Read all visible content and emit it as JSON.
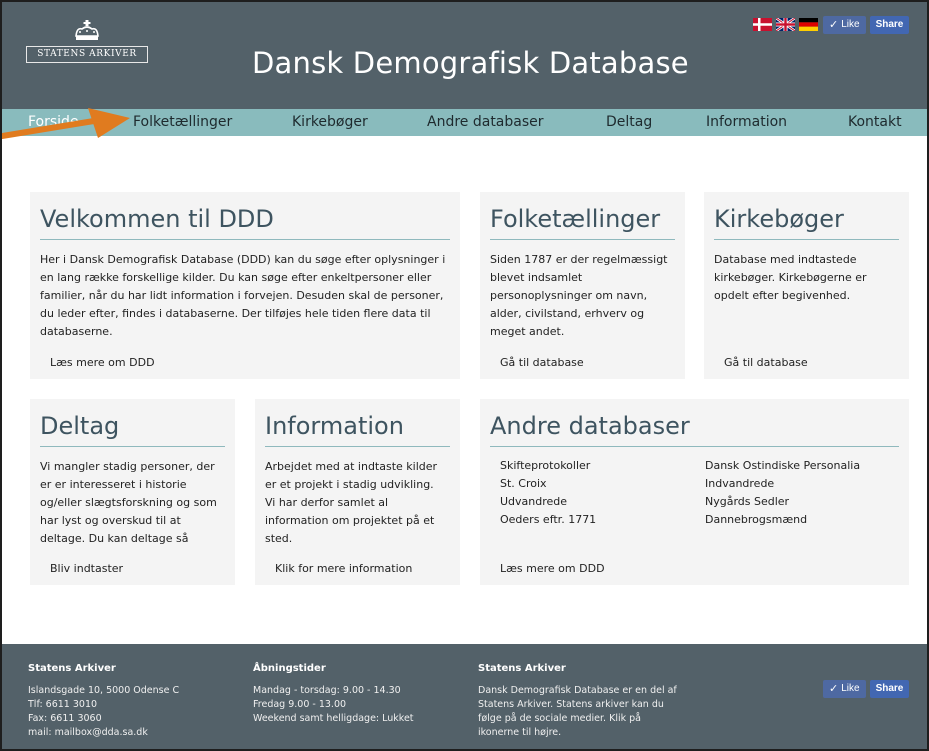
{
  "header": {
    "logo_text": "Statens Arkiver",
    "site_title": "Dansk Demografisk Database",
    "fb_like": "Like",
    "fb_share": "Share",
    "flags": [
      "danish-flag-icon",
      "uk-flag-icon",
      "german-flag-icon"
    ]
  },
  "nav": {
    "items": [
      "Forside",
      "Folketællinger",
      "Kirkebøger",
      "Andre databaser",
      "Deltag",
      "Information",
      "Kontakt"
    ]
  },
  "cards": {
    "welcome": {
      "title": "Velkommen til DDD",
      "lines": [
        "Her i Dansk Demografisk Database (DDD) kan du søge efter oplysninger i",
        "en lang række forskellige kilder. Du kan søge efter enkeltpersoner eller",
        "familier, når du har lidt information i forvejen. Desuden skal de personer,",
        "du leder efter, findes i databaserne. Der tilføjes hele tiden flere data til",
        "databaserne."
      ],
      "link": "Læs mere om DDD"
    },
    "census": {
      "title": "Folketællinger",
      "lines": [
        "Siden 1787 er der regelmæssigt",
        "blevet indsamlet",
        "personoplysninger om navn,",
        "alder, civilstand, erhverv og",
        "meget andet."
      ],
      "link": "Gå til database"
    },
    "church": {
      "title": "Kirkebøger",
      "lines": [
        "Database med indtastede",
        "kirkebøger. Kirkebøgerne er",
        "opdelt efter begivenhed."
      ],
      "link": "Gå til database"
    },
    "participate": {
      "title": "Deltag",
      "lines": [
        "Vi mangler stadig personer, der",
        "er er interesseret i historie",
        "og/eller slægtsforskning og som",
        "har lyst og overskud til at",
        "deltage. Du kan deltage så"
      ],
      "link": "Bliv indtaster"
    },
    "information": {
      "title": "Information",
      "lines": [
        "Arbejdet med at indtaste kilder",
        "er et projekt i stadig udvikling.",
        "Vi har derfor samlet al",
        "information om projektet på et",
        "sted."
      ],
      "link": "Klik for mere information"
    },
    "other": {
      "title": "Andre databaser",
      "col1": [
        "Skifteprotokoller",
        "St. Croix",
        "Udvandrede",
        "Oeders eftr. 1771"
      ],
      "col2": [
        "Dansk Ostindiske Personalia",
        "Indvandrede",
        "Nygårds Sedler",
        "Dannebrogsmænd"
      ],
      "link": "Læs mere om DDD"
    }
  },
  "footer": {
    "col1": {
      "heading": "Statens Arkiver",
      "lines": [
        "Islandsgade 10, 5000 Odense C",
        "Tlf: 6611 3010",
        "Fax: 6611 3060",
        "mail: mailbox@dda.sa.dk"
      ]
    },
    "col2": {
      "heading": "Åbningstider",
      "lines": [
        "Mandag - torsdag: 9.00 - 14.30",
        "Fredag 9.00 - 13.00",
        "Weekend samt helligdage: Lukket"
      ]
    },
    "col3": {
      "heading": "Statens Arkiver",
      "lines": [
        "Dansk Demografisk Database er en del af",
        "Statens Arkiver. Statens arkiver kan du",
        "følge på de sociale medier. Klik på",
        "ikonerne til højre."
      ]
    },
    "fb_like": "Like",
    "fb_share": "Share"
  },
  "colors": {
    "header_bg": "#536169",
    "nav_bg": "#89bbbd",
    "card_bg": "#f4f4f4",
    "accent_arrow": "#e07b1f"
  }
}
